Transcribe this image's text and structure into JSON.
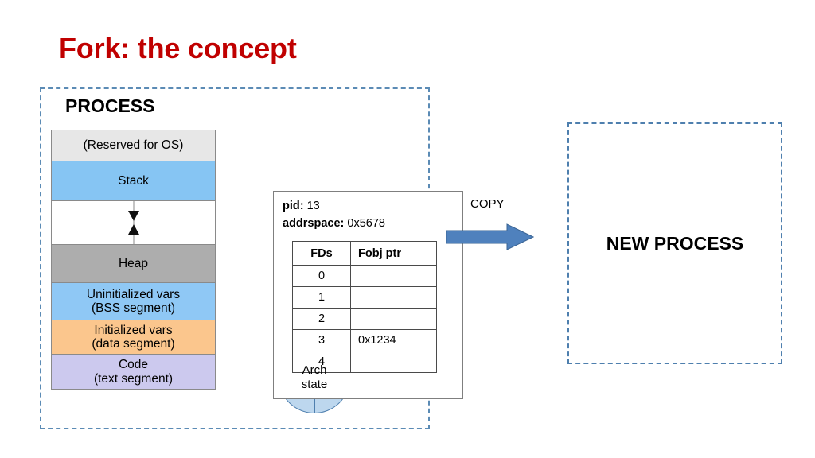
{
  "slide": {
    "title": "Fork: the concept",
    "title_color": "#C00000",
    "background": "#FFFFFF"
  },
  "process_panel": {
    "heading": "PROCESS",
    "border_color": "#5B8BB5",
    "border_style": "dashed",
    "memory_map": {
      "segments": [
        {
          "label_line1": "(Reserved for OS)",
          "label_line2": "",
          "color": "#E7E7E7"
        },
        {
          "label_line1": "Stack",
          "label_line2": "",
          "color": "#86C5F3"
        },
        {
          "label_line1": "",
          "label_line2": "",
          "color": "#FFFFFF"
        },
        {
          "label_line1": "Heap",
          "label_line2": "",
          "color": "#ADADAD"
        },
        {
          "label_line1": "Uninitialized vars",
          "label_line2": "(BSS segment)",
          "color": "#8FC8F5"
        },
        {
          "label_line1": "Initialized vars",
          "label_line2": "(data segment)",
          "color": "#FBC68D"
        },
        {
          "label_line1": "Code",
          "label_line2": "(text segment)",
          "color": "#CCC9EE"
        }
      ]
    },
    "arch_state": {
      "label_line1": "Arch",
      "label_line2": "state",
      "fill_color": "#BDD7EE",
      "stroke_color": "#4E7FAE"
    },
    "pcb": {
      "pid_key": "pid:",
      "pid_value": "13",
      "addrspace_key": "addrspace:",
      "addrspace_value": "0x5678",
      "fd_table": {
        "headers": [
          "FDs",
          "Fobj ptr"
        ],
        "rows": [
          {
            "fd": "0",
            "ptr": ""
          },
          {
            "fd": "1",
            "ptr": ""
          },
          {
            "fd": "2",
            "ptr": ""
          },
          {
            "fd": "3",
            "ptr": "0x1234"
          },
          {
            "fd": "4",
            "ptr": ""
          }
        ]
      }
    }
  },
  "copy_transition": {
    "label": "COPY",
    "arrow_color": "#4F81BD",
    "arrow_stroke": "#3A6494"
  },
  "new_process_panel": {
    "label": "NEW PROCESS",
    "border_color": "#4E7FAE",
    "border_style": "dashed"
  }
}
